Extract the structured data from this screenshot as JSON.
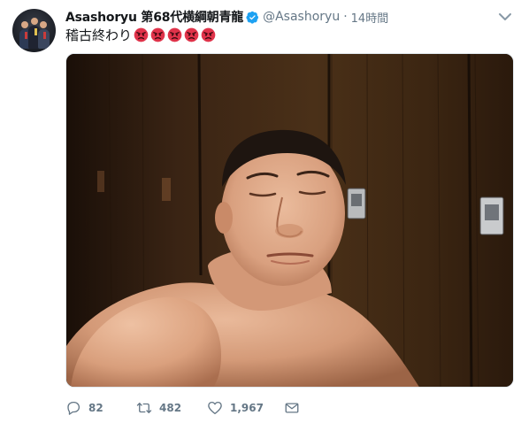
{
  "tweet": {
    "display_name": "Asashoryu 第68代横綱朝青龍",
    "handle": "@Asashoryu",
    "separator": "·",
    "time": "14時間",
    "text": "稽古終わり",
    "emoji_count": 5,
    "emoji_name": "angry-face-icon",
    "verified": true
  },
  "actions": {
    "reply_count": "82",
    "retweet_count": "482",
    "like_count": "1,967"
  },
  "colors": {
    "verified_blue": "#1da1f2",
    "secondary_text": "#657786",
    "emoji_red": "#e0334a"
  }
}
